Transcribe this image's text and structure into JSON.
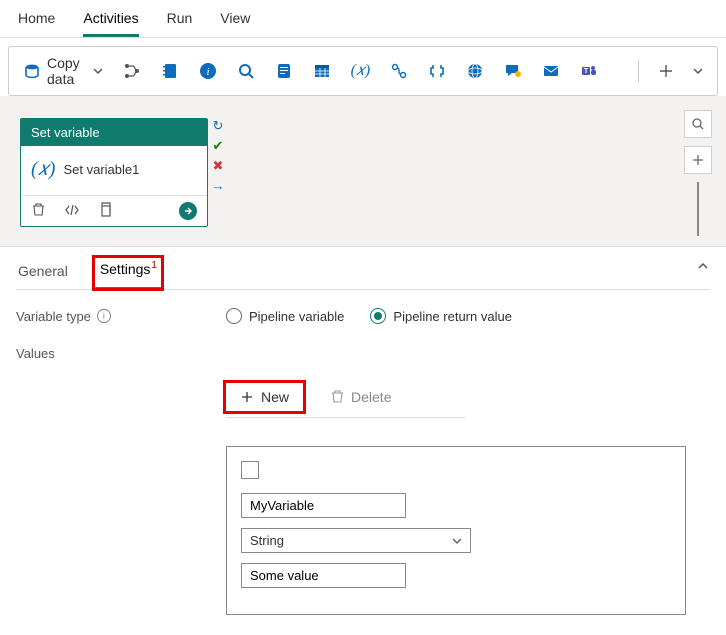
{
  "nav": {
    "tabs": [
      "Home",
      "Activities",
      "Run",
      "View"
    ],
    "active": 1
  },
  "toolbar": {
    "copy_label": "Copy data"
  },
  "card": {
    "header": "Set variable",
    "title": "Set variable1"
  },
  "panel": {
    "tabs": {
      "general": "General",
      "settings": "Settings",
      "badge": "1"
    },
    "variable_type_label": "Variable type",
    "radio1": "Pipeline variable",
    "radio2": "Pipeline return value",
    "values_label": "Values",
    "new_btn": "New",
    "delete_btn": "Delete",
    "row": {
      "name": "MyVariable",
      "type": "String",
      "value": "Some value"
    }
  }
}
